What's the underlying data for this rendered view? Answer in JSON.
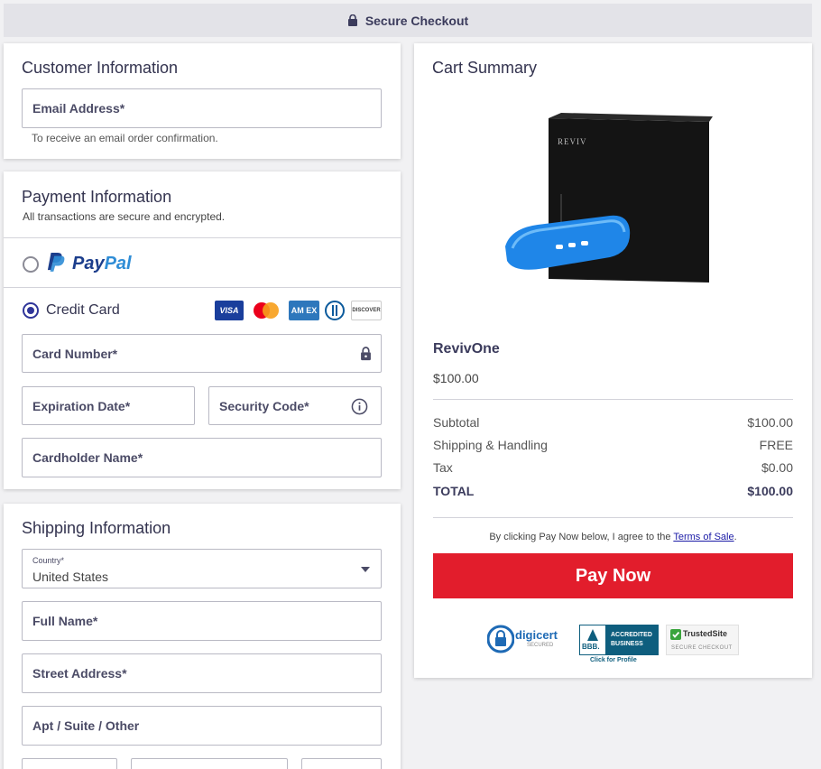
{
  "header": {
    "title": "Secure Checkout",
    "icon": "lock-icon"
  },
  "customer": {
    "title": "Customer Information",
    "email_label": "Email Address*",
    "email_hint": "To receive an email order confirmation."
  },
  "payment": {
    "title": "Payment Information",
    "subtitle": "All transactions are secure and encrypted.",
    "paypal_word_1": "Pay",
    "paypal_word_2": "Pal",
    "credit_card_label": "Credit Card",
    "card_brands": [
      "VISA",
      "MASTERCARD",
      "AMEX",
      "DINERS",
      "DISCOVER"
    ],
    "visa_text": "VISA",
    "amex_text": "AM EX",
    "discover_text": "DISCOVER",
    "card_number_label": "Card Number*",
    "expiration_label": "Expiration Date*",
    "security_code_label": "Security Code*",
    "cardholder_label": "Cardholder Name*"
  },
  "shipping": {
    "title": "Shipping Information",
    "country_label": "Country*",
    "country_value": "United States",
    "full_name_label": "Full Name*",
    "street_label": "Street Address*",
    "apt_label": "Apt / Suite / Other"
  },
  "cart": {
    "title": "Cart Summary",
    "product_name": "RevivOne",
    "product_price": "$100.00",
    "box_brand": "REVIV",
    "subtotal_label": "Subtotal",
    "subtotal_value": "$100.00",
    "shipping_label": "Shipping & Handling",
    "shipping_value": "FREE",
    "tax_label": "Tax",
    "tax_value": "$0.00",
    "total_label": "TOTAL",
    "total_value": "$100.00",
    "terms_prefix": "By clicking Pay Now below, I agree to the ",
    "terms_link": "Terms of Sale",
    "terms_suffix": ".",
    "pay_button": "Pay Now"
  },
  "badges": {
    "digicert": "digicert",
    "digicert_sub": "SECURED",
    "bbb_line1": "ACCREDITED",
    "bbb_line2": "BUSINESS",
    "bbb_mark": "BBB.",
    "bbb_link": "Click for Profile",
    "trusted": "TrustedSite",
    "trusted_sub": "SECURE CHECKOUT"
  },
  "colors": {
    "accent": "#2f3599",
    "pay_button": "#e21d2c",
    "text": "#3b3b5c"
  }
}
